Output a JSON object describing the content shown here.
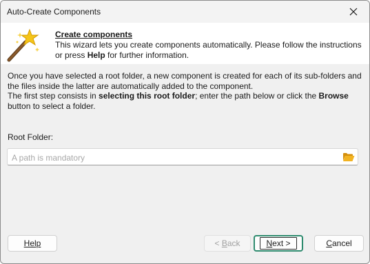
{
  "window": {
    "title": "Auto-Create Components",
    "close_icon": "close-icon"
  },
  "header": {
    "title": "Create components",
    "desc_part1": "This wizard lets you create components automatically. Please follow the instructions or press ",
    "desc_bold": "Help",
    "desc_part2": " for further information.",
    "icon": "magic-wand-icon"
  },
  "body": {
    "para1": "Once you have selected a root folder, a new component is created for each of its sub-folders and the files inside the latter are automatically added to the component.",
    "para2_part1": "The first step consists in ",
    "para2_bold1": "selecting this root folder",
    "para2_part2": "; enter the path below or click the ",
    "para2_bold2": "Browse",
    "para2_part3": " button to select a folder."
  },
  "root_folder": {
    "label": "Root Folder:",
    "value": "",
    "placeholder": "A path is mandatory",
    "browse_icon": "folder-open-icon"
  },
  "buttons": {
    "help": "Help",
    "back": "< Back",
    "back_mnemonic": "B",
    "next": "Next >",
    "next_mnemonic": "N",
    "cancel": "Cancel",
    "cancel_mnemonic": "C"
  },
  "colors": {
    "dialog_bg": "#f0f0f0",
    "header_bg": "#ffffff",
    "focus_ring": "#2e8b6e",
    "folder_icon": "#e8a317",
    "placeholder": "#a8a8a8"
  }
}
